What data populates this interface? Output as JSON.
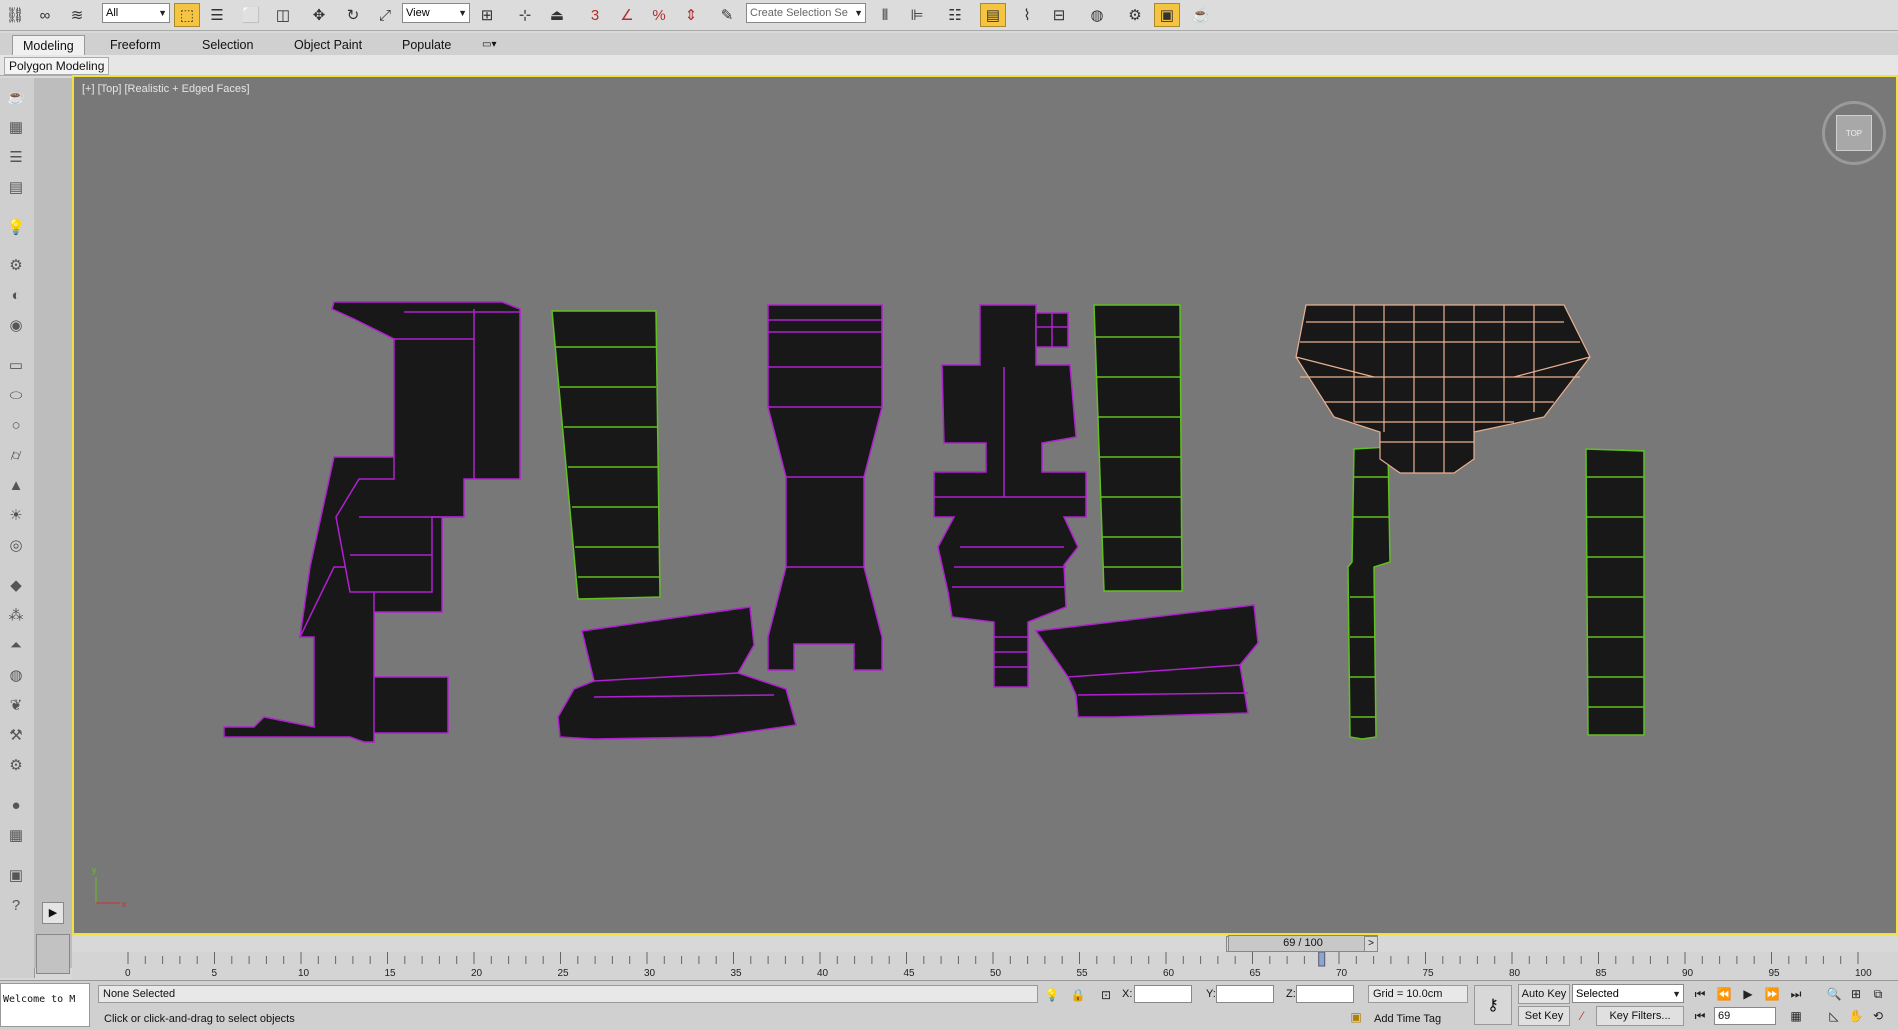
{
  "toolbar": {
    "filter_value": "All",
    "ref_coord_value": "View",
    "selection_set_placeholder": "Create Selection Se",
    "icons": [
      "link-icon",
      "unlink-icon",
      "bind-spacewarp-icon",
      "select-object-icon",
      "select-by-name-icon",
      "rect-region-icon",
      "window-crossing-icon",
      "move-icon",
      "rotate-icon",
      "scale-icon",
      "pivot-icon",
      "manipulate-icon",
      "snap-icon",
      "angle-snap-icon",
      "percent-snap-icon",
      "spinner-snap-icon",
      "edit-named-sel-icon",
      "mirror-icon",
      "align-icon",
      "layer-icon",
      "graphite-icon",
      "curve-editor-icon",
      "schematic-icon",
      "material-editor-icon",
      "render-setup-icon",
      "rendered-frame-icon",
      "render-icon"
    ]
  },
  "ribbon": {
    "tabs": [
      "Modeling",
      "Freeform",
      "Selection",
      "Object Paint",
      "Populate"
    ],
    "active_tab": "Modeling",
    "sub_label": "Polygon Modeling"
  },
  "viewport": {
    "label": "[+] [Top] [Realistic + Edged Faces]",
    "viewcube_label": "TOP",
    "axis_x": "x",
    "axis_y": "y"
  },
  "timeline": {
    "slider_text": "69 / 100",
    "current_frame": 69,
    "total_frames": 100,
    "ticks": [
      "0",
      "5",
      "10",
      "15",
      "20",
      "25",
      "30",
      "35",
      "40",
      "45",
      "50",
      "55",
      "60",
      "65",
      "70",
      "75",
      "80",
      "85",
      "90",
      "95",
      "100"
    ]
  },
  "status": {
    "script_listener": "Welcome to M",
    "selection_text": "None Selected",
    "prompt_text": "Click or click-and-drag to select objects",
    "x_label": "X:",
    "y_label": "Y:",
    "z_label": "Z:",
    "grid_text": "Grid = 10.0cm",
    "add_time_tag": "Add Time Tag",
    "auto_key": "Auto Key",
    "set_key": "Set Key",
    "key_mode_value": "Selected",
    "key_filters": "Key Filters...",
    "frame_value": "69"
  },
  "colors": {
    "viewport_bg": "#787878",
    "viewport_border": "#f0e040",
    "mesh_fill": "#181818",
    "edge_purple": "#b020d0",
    "edge_green": "#60c020",
    "edge_selected": "#e8b090"
  }
}
